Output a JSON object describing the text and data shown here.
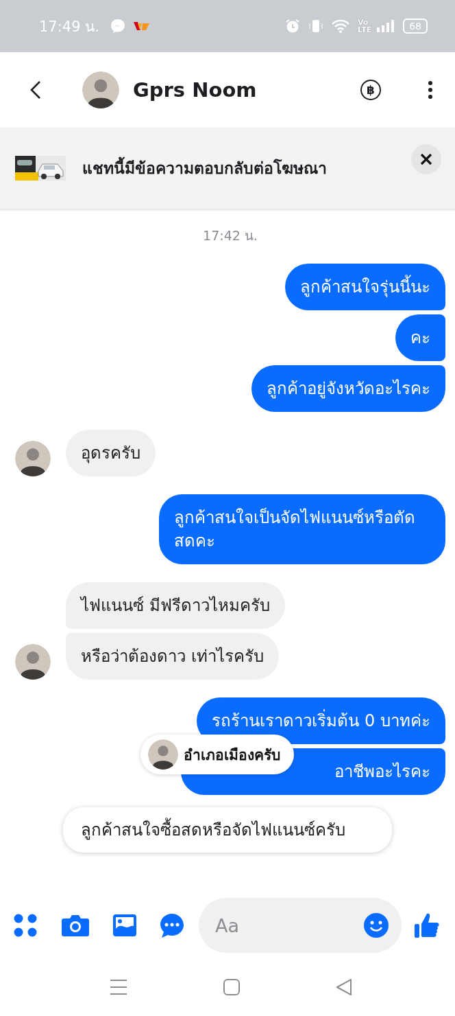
{
  "status_bar": {
    "time": "17:49 น.",
    "volte_top": "Vo",
    "volte_bottom": "LTE",
    "battery": "68"
  },
  "header": {
    "name": "Gprs Noom",
    "payment_symbol": "฿"
  },
  "ad_banner": {
    "text": "แชทนี้มีข้อความตอบกลับต่อโฆษณา"
  },
  "messages": [
    {
      "kind": "timestamp",
      "text": "17:42 น."
    },
    {
      "kind": "outgoing",
      "text": "ลูกค้าสนใจรุ่นนี้นะ"
    },
    {
      "kind": "outgoing",
      "text": "คะ"
    },
    {
      "kind": "outgoing",
      "text": "ลูกค้าอยู่จังหวัดอะไรคะ"
    },
    {
      "kind": "incoming",
      "text": "อุดรครับ",
      "show_avatar": true
    },
    {
      "kind": "outgoing",
      "text": "ลูกค้าสนใจเป็นจัดไฟแนนซ์หรือตัดสดคะ"
    },
    {
      "kind": "incoming",
      "text": "ไฟแนนซ์ มีฟรีดาวไหมครับ",
      "show_avatar": false
    },
    {
      "kind": "incoming",
      "text": "หรือว่าต้องดาว เท่าไรครับ",
      "show_avatar": true
    },
    {
      "kind": "outgoing",
      "text": "รถร้านเราดาวเริ่มต้น 0 บาทค่ะ"
    },
    {
      "kind": "outgoing",
      "text": "อาชีพอะไรคะ",
      "covered": true
    }
  ],
  "reply_popup": {
    "text": "อำเภอเมืองครับ"
  },
  "suggested_reply": {
    "text": "ลูกค้าสนใจซื้อสดหรือจัดไฟแนนซ์ครับ"
  },
  "composer": {
    "placeholder": "Aa"
  }
}
